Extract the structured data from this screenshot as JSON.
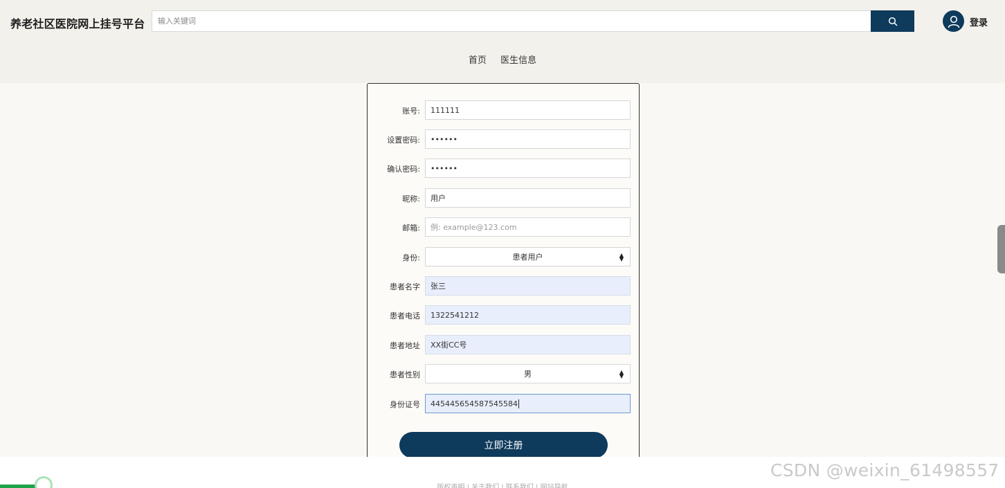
{
  "header": {
    "brand": "养老社区医院网上挂号平台",
    "search_placeholder": "输入关键词",
    "search_icon": "search-icon",
    "avatar_icon": "user-avatar-icon",
    "login": "登录"
  },
  "nav": {
    "items": [
      {
        "label": "首页"
      },
      {
        "label": "医生信息"
      }
    ]
  },
  "form": {
    "fields": [
      {
        "label": "账号:",
        "value": "111111"
      },
      {
        "label": "设置密码:",
        "value": "••••••"
      },
      {
        "label": "确认密码:",
        "value": "••••••"
      },
      {
        "label": "昵称:",
        "value": "用户"
      },
      {
        "label": "邮箱:",
        "placeholder": "例: example@123.com"
      },
      {
        "label": "身份:",
        "value": "患者用户"
      },
      {
        "label": "患者名字",
        "value": "张三"
      },
      {
        "label": "患者电话",
        "value": "1322541212"
      },
      {
        "label": "患者地址",
        "value": "XX街CC号"
      },
      {
        "label": "患者性别",
        "value": "男"
      },
      {
        "label": "身份证号",
        "value": "445445654587545584"
      }
    ],
    "submit": "立即注册"
  },
  "footer": {
    "links": "版权声明 | 关于我们 | 联系我们 | 网站导航"
  },
  "watermark": "CSDN @weixin_61498557",
  "colors": {
    "primary": "#0e3a5c",
    "header_bg": "#f3f1ec",
    "page_bg": "#f9f8f4",
    "autofill_bg": "#e8eefb"
  }
}
